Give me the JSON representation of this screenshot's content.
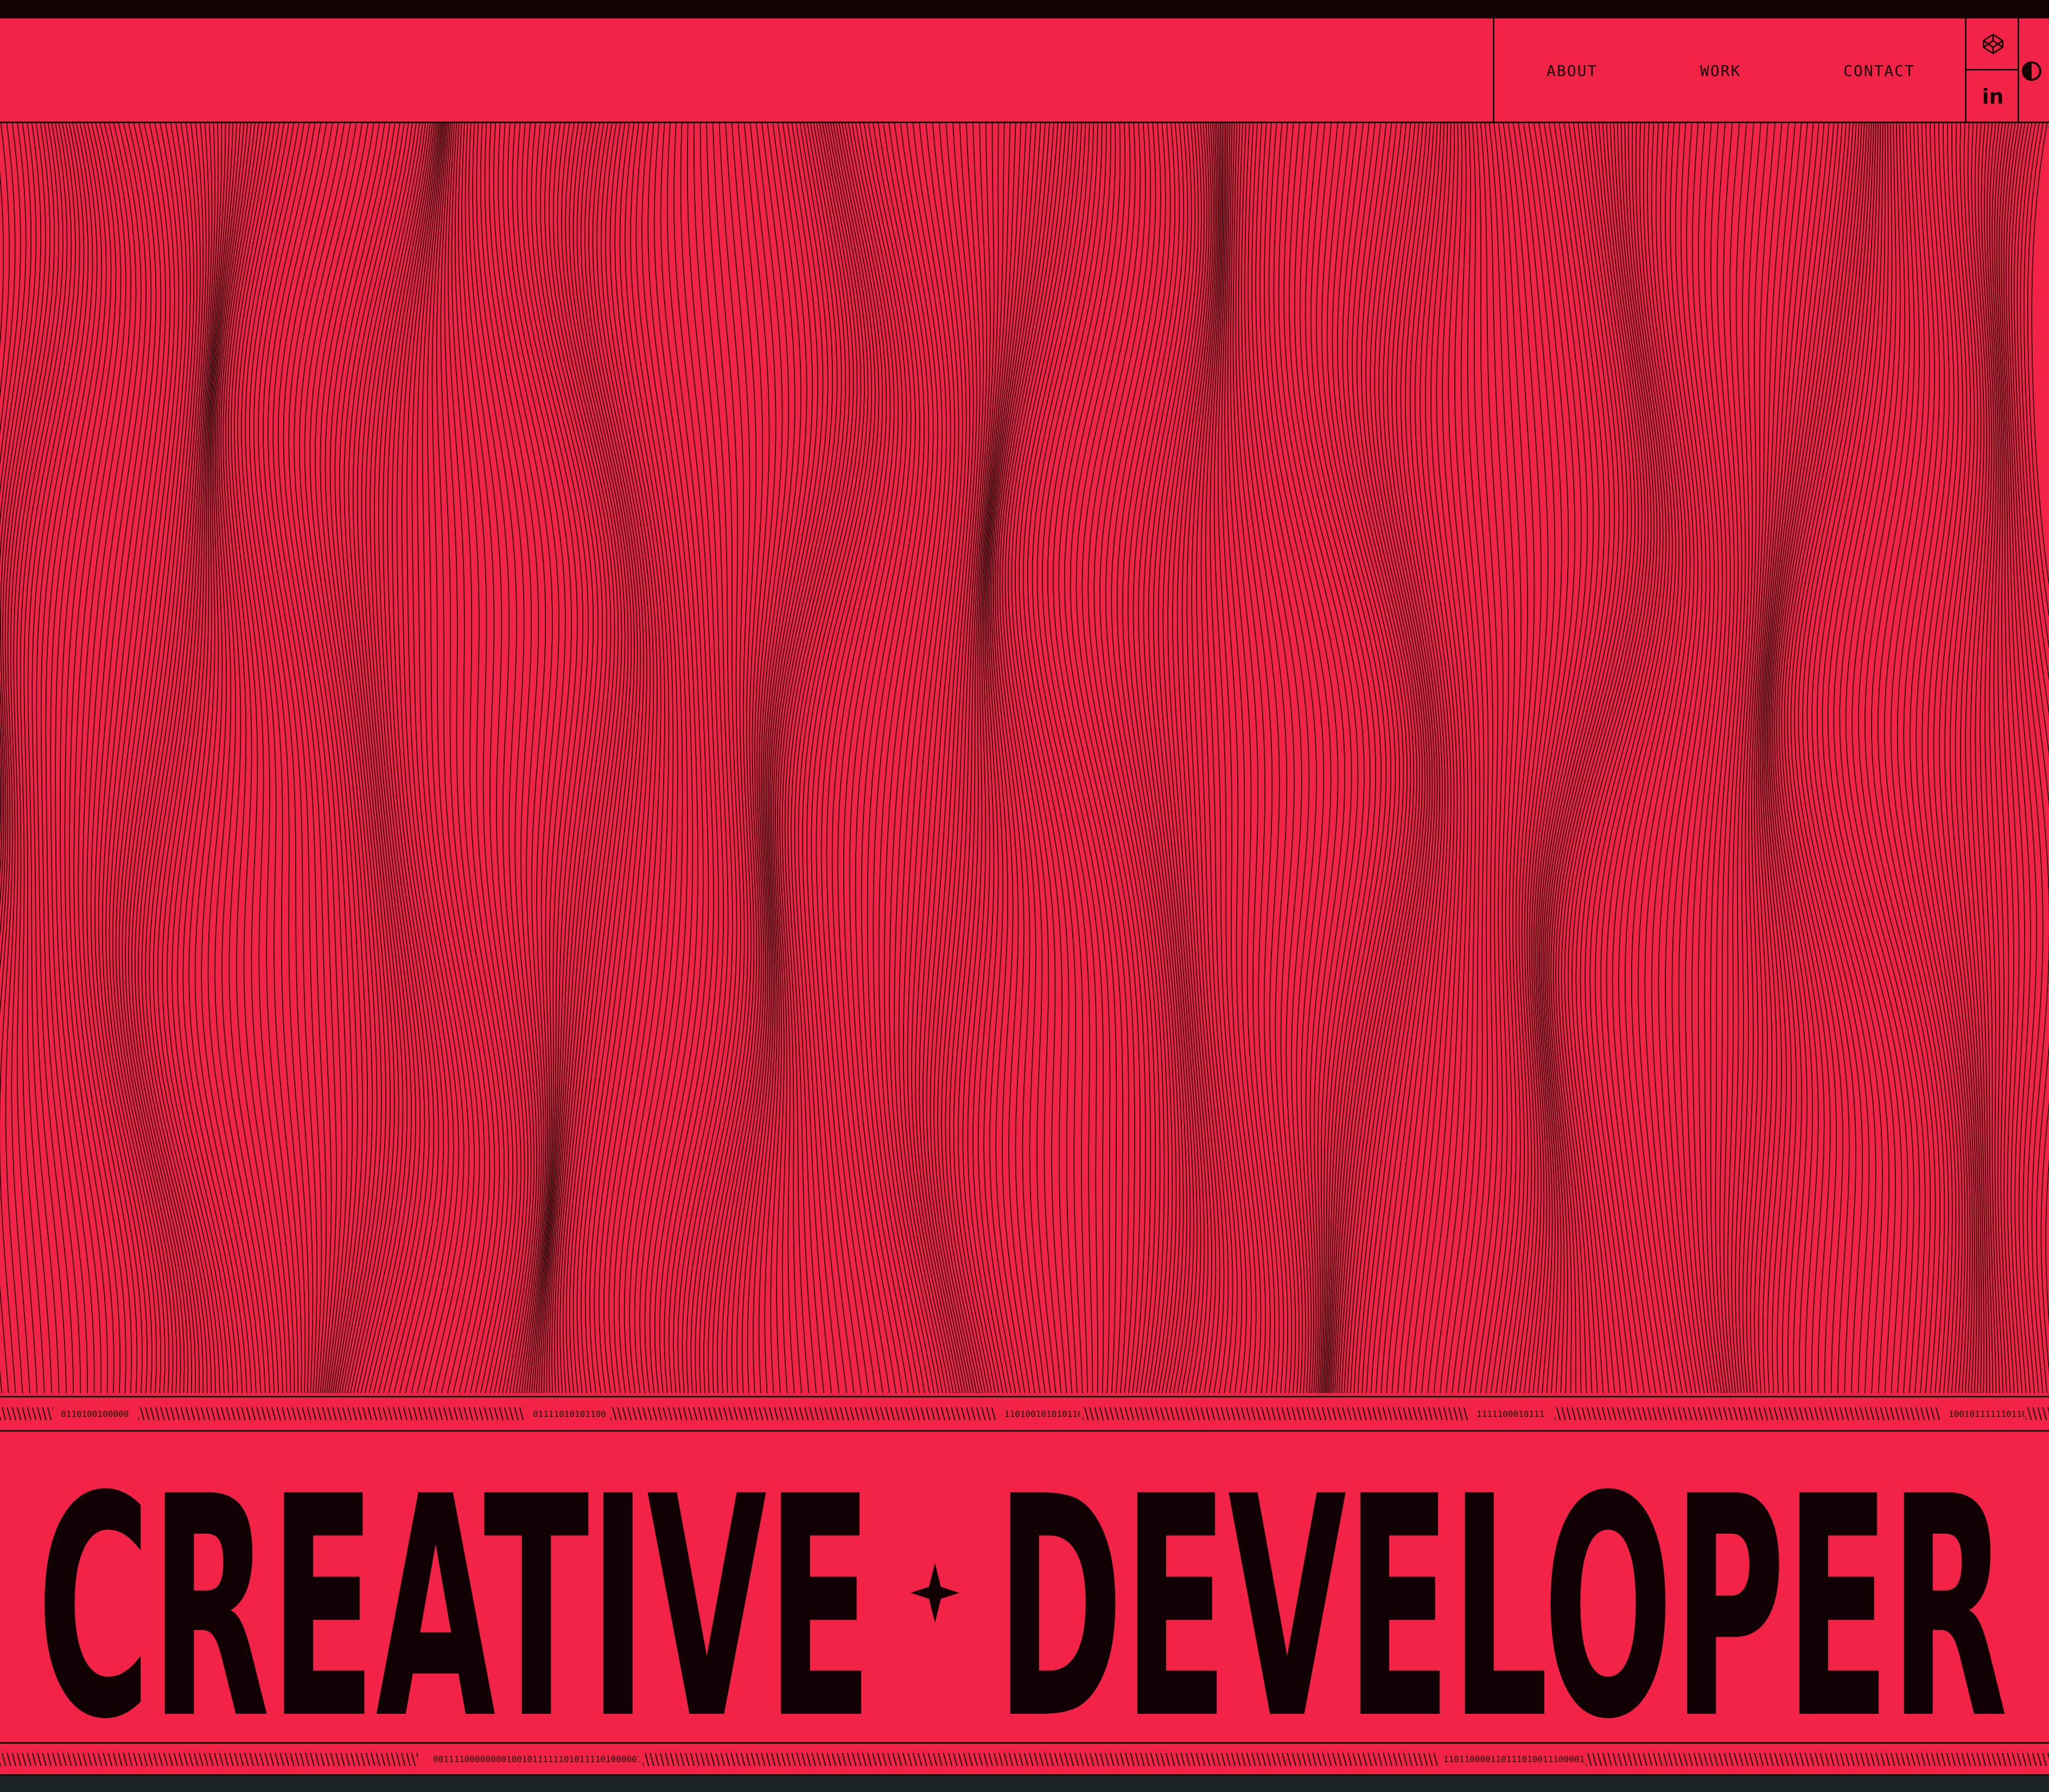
{
  "nav": {
    "items": [
      {
        "label": "ABOUT"
      },
      {
        "label": "WORK"
      },
      {
        "label": "CONTACT"
      }
    ]
  },
  "social": {
    "codepen_icon": "codepen-icon",
    "linkedin_icon": "linkedin-icon",
    "linkedin_label": "in",
    "theme_icon": "theme-toggle-icon"
  },
  "binary_top": [
    "0110100100000",
    "01111010101100",
    "1101001010101101",
    "1111100010111",
    "1001011111101101"
  ],
  "binary_bottom": [
    "001111000000001001011111101011110100000111",
    "110110000110111010011100001"
  ],
  "headline": {
    "word1": "CREATIVE",
    "word2": "DEVELOPER",
    "separator_icon": "four-point-star-icon"
  },
  "colors": {
    "accent": "#f32347",
    "ink": "#150205",
    "footer": "#1c2326"
  }
}
